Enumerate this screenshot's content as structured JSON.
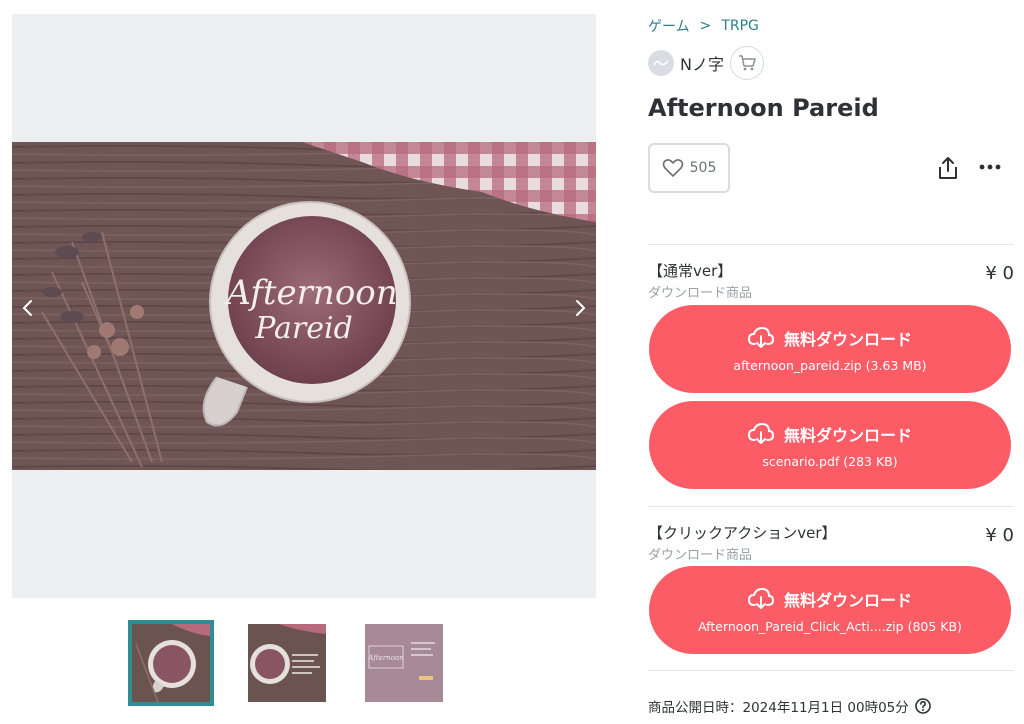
{
  "breadcrumb": {
    "category": "ゲーム",
    "separator": ">",
    "subcategory": "TRPG"
  },
  "shop": {
    "name": "Nノ字",
    "avatar_icon": "scribble-avatar-icon",
    "cart_icon": "cart-icon"
  },
  "product": {
    "title": "Afternoon Pareid",
    "likes": "505",
    "cover_text_line1": "Afternoon",
    "cover_text_line2": "Pareid"
  },
  "variants": [
    {
      "name": "【通常ver】",
      "type": "ダウンロード商品",
      "price": "¥ 0",
      "downloads": [
        {
          "label": "無料ダウンロード",
          "file": "afternoon_pareid.zip (3.63 MB)"
        },
        {
          "label": "無料ダウンロード",
          "file": "scenario.pdf (283 KB)"
        }
      ]
    },
    {
      "name": "【クリックアクションver】",
      "type": "ダウンロード商品",
      "price": "¥ 0",
      "downloads": [
        {
          "label": "無料ダウンロード",
          "file": "Afternoon_Pareid_Click_Acti....zip (805 KB)"
        }
      ]
    }
  ],
  "published": "商品公開日時：2024年11月1日 00時05分",
  "colors": {
    "accent": "#fc5c66",
    "link": "#2f7f86",
    "thumb_selected": "#2f8e94"
  }
}
